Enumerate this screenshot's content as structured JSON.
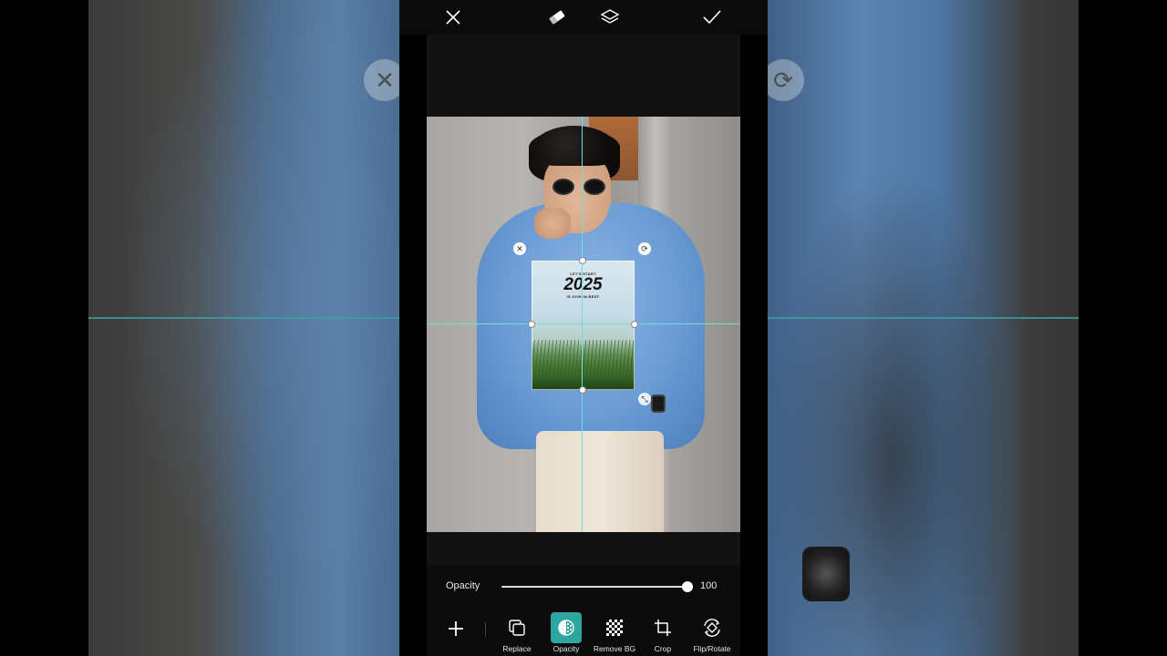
{
  "topbar": {
    "close_icon": "close-icon",
    "eraser_icon": "eraser-icon",
    "layers_icon": "layers-icon",
    "confirm_icon": "check-icon"
  },
  "poster": {
    "top_text": "LET'S START",
    "title": "2025",
    "sub_text": "IS GIVE IN BEST"
  },
  "opacity": {
    "label": "Opacity",
    "value": "100",
    "level": 1.0
  },
  "tools": [
    {
      "label": "Replace",
      "icon": "replace-icon"
    },
    {
      "label": "Opacity",
      "icon": "opacity-icon"
    },
    {
      "label": "Remove BG",
      "icon": "remove-bg-icon"
    },
    {
      "label": "Crop",
      "icon": "crop-icon"
    },
    {
      "label": "Flip/Rotate",
      "icon": "flip-rotate-icon"
    }
  ],
  "colors": {
    "accent": "#2ea6a0",
    "guide": "#6fe0dc"
  }
}
